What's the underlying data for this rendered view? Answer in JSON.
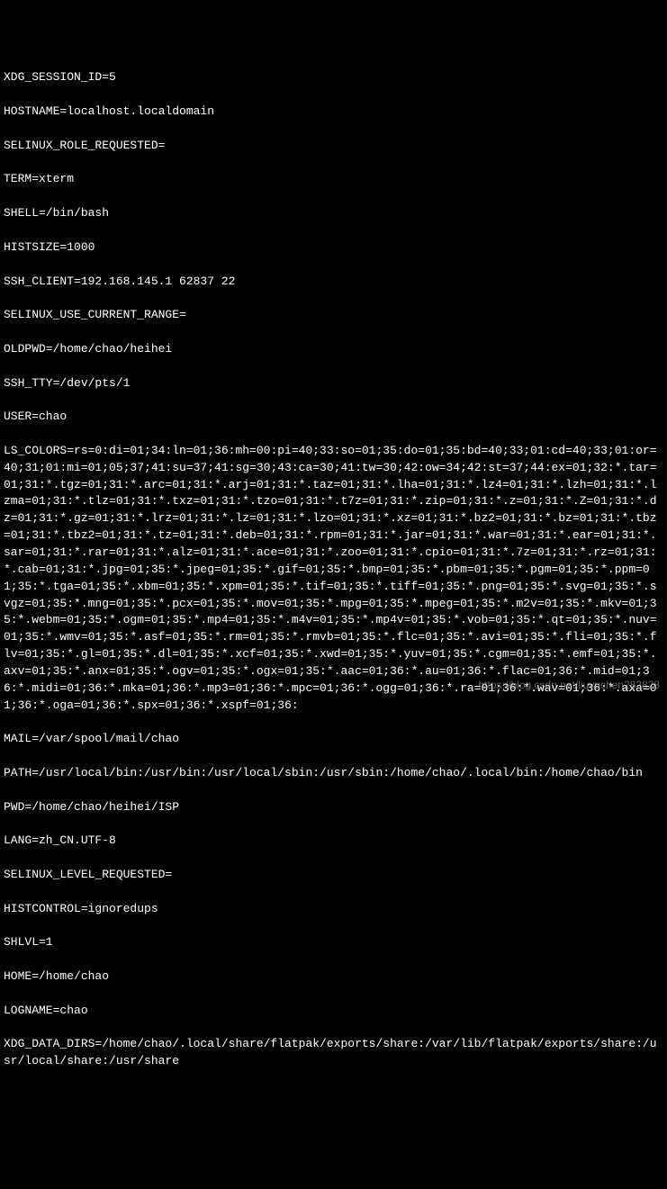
{
  "env": {
    "xdg_session_id": "XDG_SESSION_ID=5",
    "hostname": "HOSTNAME=localhost.localdomain",
    "selinux_role_requested": "SELINUX_ROLE_REQUESTED=",
    "term": "TERM=xterm",
    "shell": "SHELL=/bin/bash",
    "histsize": "HISTSIZE=1000",
    "ssh_client": "SSH_CLIENT=192.168.145.1 62837 22",
    "selinux_use_current_range": "SELINUX_USE_CURRENT_RANGE=",
    "oldpwd": "OLDPWD=/home/chao/heihei",
    "ssh_tty": "SSH_TTY=/dev/pts/1",
    "user": "USER=chao",
    "ls_colors": "LS_COLORS=rs=0:di=01;34:ln=01;36:mh=00:pi=40;33:so=01;35:do=01;35:bd=40;33;01:cd=40;33;01:or=40;31;01:mi=01;05;37;41:su=37;41:sg=30;43:ca=30;41:tw=30;42:ow=34;42:st=37;44:ex=01;32:*.tar=01;31:*.tgz=01;31:*.arc=01;31:*.arj=01;31:*.taz=01;31:*.lha=01;31:*.lz4=01;31:*.lzh=01;31:*.lzma=01;31:*.tlz=01;31:*.txz=01;31:*.tzo=01;31:*.t7z=01;31:*.zip=01;31:*.z=01;31:*.Z=01;31:*.dz=01;31:*.gz=01;31:*.lrz=01;31:*.lz=01;31:*.lzo=01;31:*.xz=01;31:*.bz2=01;31:*.bz=01;31:*.tbz=01;31:*.tbz2=01;31:*.tz=01;31:*.deb=01;31:*.rpm=01;31:*.jar=01;31:*.war=01;31:*.ear=01;31:*.sar=01;31:*.rar=01;31:*.alz=01;31:*.ace=01;31:*.zoo=01;31:*.cpio=01;31:*.7z=01;31:*.rz=01;31:*.cab=01;31:*.jpg=01;35:*.jpeg=01;35:*.gif=01;35:*.bmp=01;35:*.pbm=01;35:*.pgm=01;35:*.ppm=01;35:*.tga=01;35:*.xbm=01;35:*.xpm=01;35:*.tif=01;35:*.tiff=01;35:*.png=01;35:*.svg=01;35:*.svgz=01;35:*.mng=01;35:*.pcx=01;35:*.mov=01;35:*.mpg=01;35:*.mpeg=01;35:*.m2v=01;35:*.mkv=01;35:*.webm=01;35:*.ogm=01;35:*.mp4=01;35:*.m4v=01;35:*.mp4v=01;35:*.vob=01;35:*.qt=01;35:*.nuv=01;35:*.wmv=01;35:*.asf=01;35:*.rm=01;35:*.rmvb=01;35:*.flc=01;35:*.avi=01;35:*.fli=01;35:*.flv=01;35:*.gl=01;35:*.dl=01;35:*.xcf=01;35:*.xwd=01;35:*.yuv=01;35:*.cgm=01;35:*.emf=01;35:*.axv=01;35:*.anx=01;35:*.ogv=01;35:*.ogx=01;35:*.aac=01;36:*.au=01;36:*.flac=01;36:*.mid=01;36:*.midi=01;36:*.mka=01;36:*.mp3=01;36:*.mpc=01;36:*.ogg=01;36:*.ra=01;36:*.wav=01;36:*.axa=01;36:*.oga=01;36:*.spx=01;36:*.xspf=01;36:",
    "mail": "MAIL=/var/spool/mail/chao",
    "path": "PATH=/usr/local/bin:/usr/bin:/usr/local/sbin:/usr/sbin:/home/chao/.local/bin:/home/chao/bin",
    "pwd": "PWD=/home/chao/heihei/ISP",
    "lang": "LANG=zh_CN.UTF-8",
    "selinux_level_requested": "SELINUX_LEVEL_REQUESTED=",
    "histcontrol": "HISTCONTROL=ignoredups",
    "shlvl": "SHLVL=1",
    "home": "HOME=/home/chao",
    "logname": "LOGNAME=chao",
    "xdg_data_dirs": "XDG_DATA_DIRS=/home/chao/.local/share/flatpak/exports/share:/var/lib/flatpak/exports/share:/usr/local/share:/usr/share"
  },
  "watermark": "https://blog.csdn.net/liuyuchen282828"
}
